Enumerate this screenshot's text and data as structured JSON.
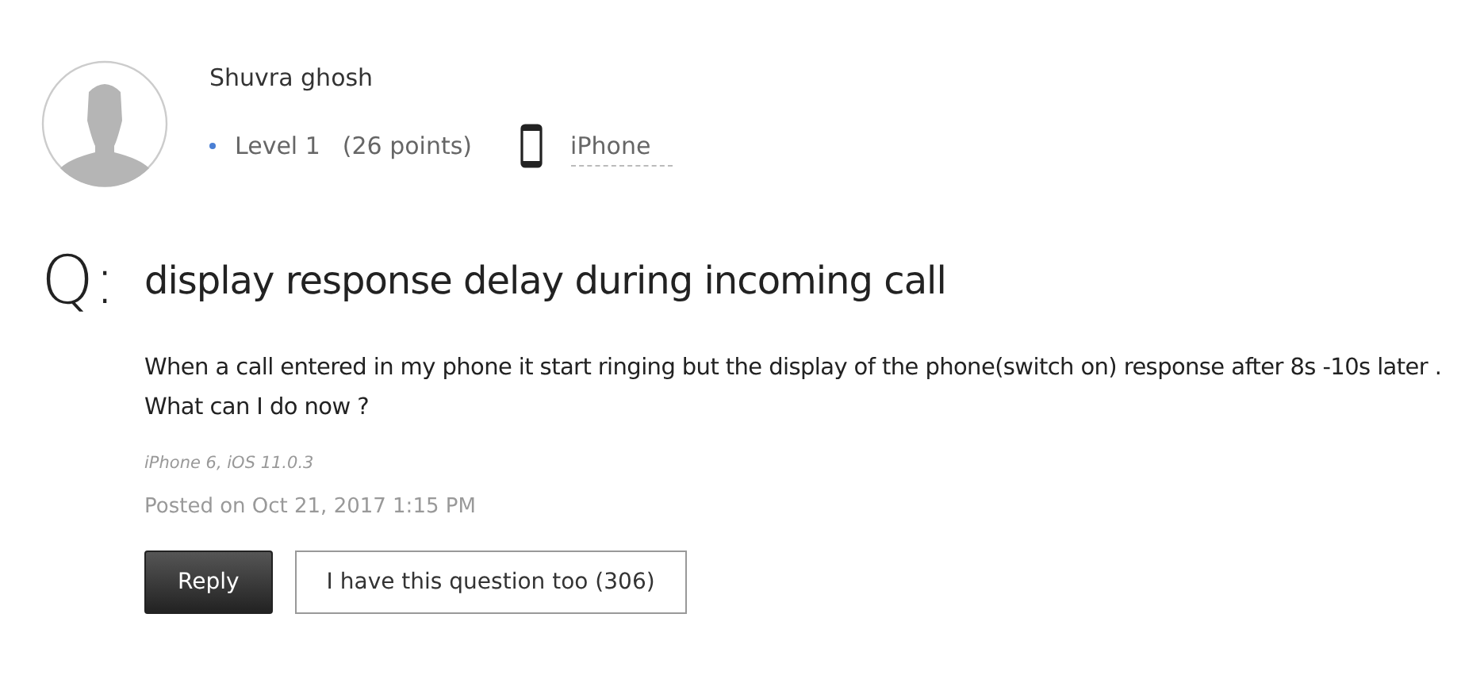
{
  "author": {
    "name": "Shuvra ghosh",
    "level": "Level 1",
    "points": "(26 points)",
    "device": "iPhone"
  },
  "question": {
    "marker": "Q:",
    "title": "display response delay during incoming call",
    "body": "When a call entered in my phone it start ringing but the display of the phone(switch on) response after 8s -10s later . What can I do now ?",
    "meta": "iPhone 6, iOS 11.0.3",
    "posted": "Posted on Oct 21, 2017 1:15 PM"
  },
  "buttons": [
    {
      "label": "Reply",
      "kind": "primary"
    },
    {
      "label": "I have this question too (306)",
      "kind": "secondary"
    }
  ]
}
